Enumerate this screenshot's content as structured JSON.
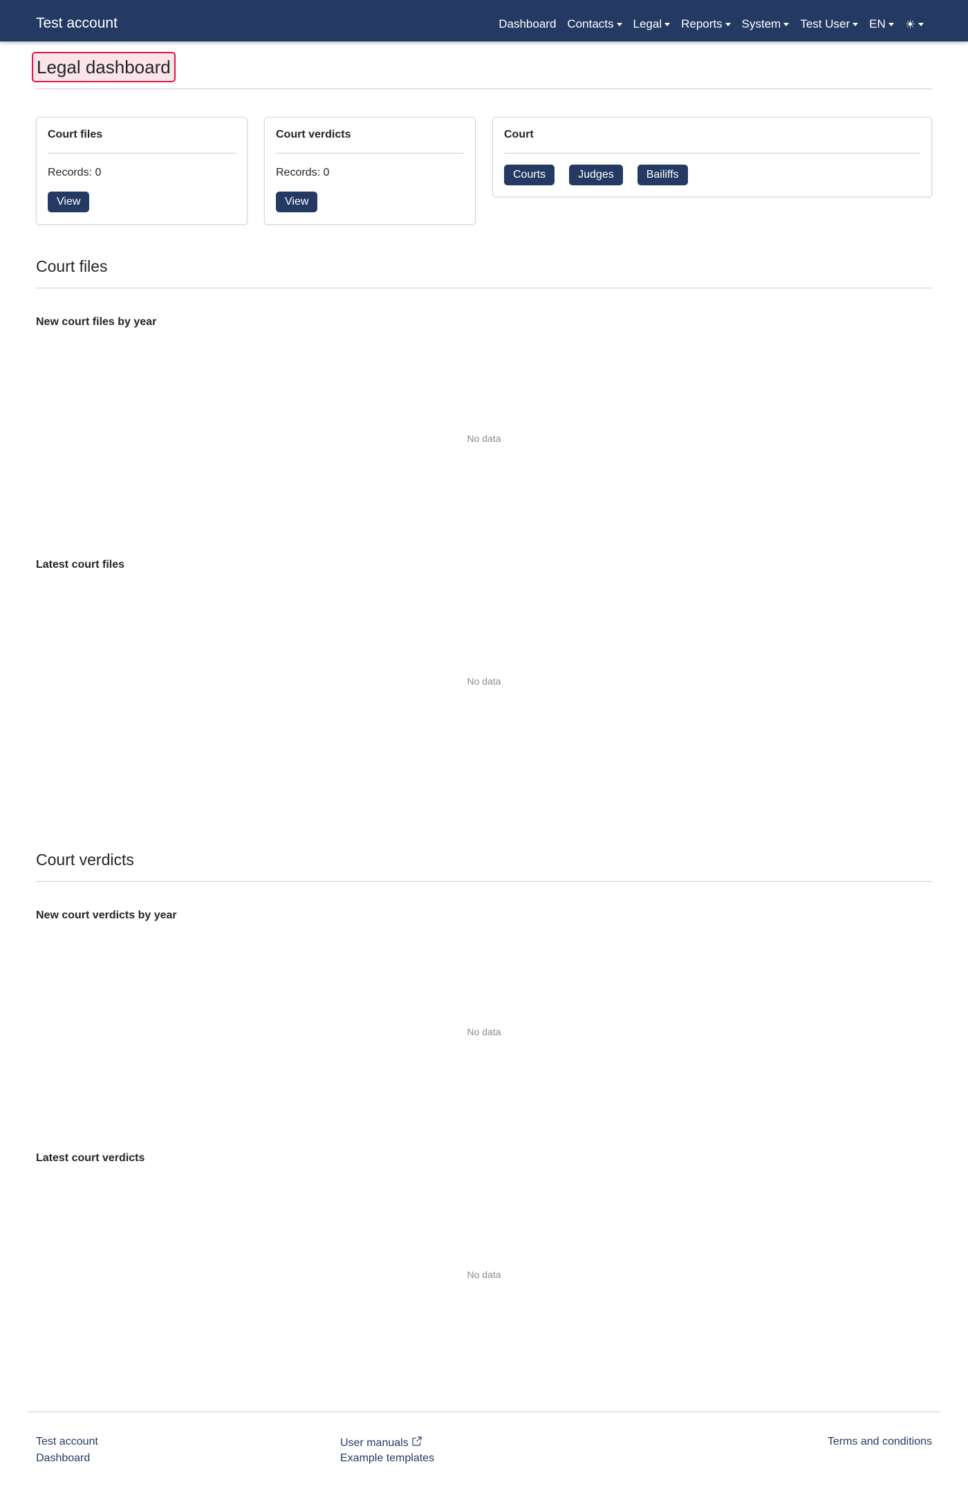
{
  "navbar": {
    "brand": "Test account",
    "items": [
      {
        "label": "Dashboard",
        "dropdown": false
      },
      {
        "label": "Contacts",
        "dropdown": true
      },
      {
        "label": "Legal",
        "dropdown": true
      },
      {
        "label": "Reports",
        "dropdown": true
      },
      {
        "label": "System",
        "dropdown": true
      },
      {
        "label": "Test User",
        "dropdown": true
      },
      {
        "label": "EN",
        "dropdown": true
      }
    ],
    "theme_icon": "sun-icon",
    "bg_color": "#253a63"
  },
  "page": {
    "title": "Legal dashboard"
  },
  "cards": {
    "court_files": {
      "title": "Court files",
      "records": "Records: 0",
      "button": "View"
    },
    "court_verdicts": {
      "title": "Court verdicts",
      "records": "Records: 0",
      "button": "View"
    },
    "court": {
      "title": "Court",
      "buttons": [
        "Courts",
        "Judges",
        "Bailiffs"
      ]
    }
  },
  "sections": {
    "court_files": {
      "title": "Court files",
      "by_year_title": "New court files by year",
      "by_year_empty": "No data",
      "latest_title": "Latest court files",
      "latest_empty": "No data"
    },
    "court_verdicts": {
      "title": "Court verdicts",
      "by_year_title": "New court verdicts by year",
      "by_year_empty": "No data",
      "latest_title": "Latest court verdicts",
      "latest_empty": "No data"
    }
  },
  "footer": {
    "account": "Test account",
    "dashboard": "Dashboard",
    "user_manuals": "User manuals",
    "example_templates": "Example templates",
    "terms": "Terms and conditions",
    "external_icon": "external-link-icon"
  },
  "colors": {
    "primary": "#253a63",
    "highlight_border": "#d81b47",
    "highlight_bg": "#fbe4ea"
  }
}
